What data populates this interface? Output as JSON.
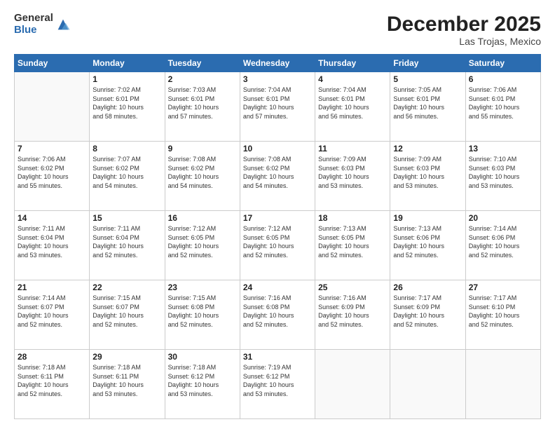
{
  "header": {
    "logo_general": "General",
    "logo_blue": "Blue",
    "month_title": "December 2025",
    "location": "Las Trojas, Mexico"
  },
  "days_of_week": [
    "Sunday",
    "Monday",
    "Tuesday",
    "Wednesday",
    "Thursday",
    "Friday",
    "Saturday"
  ],
  "weeks": [
    [
      {
        "day": "",
        "info": ""
      },
      {
        "day": "1",
        "info": "Sunrise: 7:02 AM\nSunset: 6:01 PM\nDaylight: 10 hours\nand 58 minutes."
      },
      {
        "day": "2",
        "info": "Sunrise: 7:03 AM\nSunset: 6:01 PM\nDaylight: 10 hours\nand 57 minutes."
      },
      {
        "day": "3",
        "info": "Sunrise: 7:04 AM\nSunset: 6:01 PM\nDaylight: 10 hours\nand 57 minutes."
      },
      {
        "day": "4",
        "info": "Sunrise: 7:04 AM\nSunset: 6:01 PM\nDaylight: 10 hours\nand 56 minutes."
      },
      {
        "day": "5",
        "info": "Sunrise: 7:05 AM\nSunset: 6:01 PM\nDaylight: 10 hours\nand 56 minutes."
      },
      {
        "day": "6",
        "info": "Sunrise: 7:06 AM\nSunset: 6:01 PM\nDaylight: 10 hours\nand 55 minutes."
      }
    ],
    [
      {
        "day": "7",
        "info": "Sunrise: 7:06 AM\nSunset: 6:02 PM\nDaylight: 10 hours\nand 55 minutes."
      },
      {
        "day": "8",
        "info": "Sunrise: 7:07 AM\nSunset: 6:02 PM\nDaylight: 10 hours\nand 54 minutes."
      },
      {
        "day": "9",
        "info": "Sunrise: 7:08 AM\nSunset: 6:02 PM\nDaylight: 10 hours\nand 54 minutes."
      },
      {
        "day": "10",
        "info": "Sunrise: 7:08 AM\nSunset: 6:02 PM\nDaylight: 10 hours\nand 54 minutes."
      },
      {
        "day": "11",
        "info": "Sunrise: 7:09 AM\nSunset: 6:03 PM\nDaylight: 10 hours\nand 53 minutes."
      },
      {
        "day": "12",
        "info": "Sunrise: 7:09 AM\nSunset: 6:03 PM\nDaylight: 10 hours\nand 53 minutes."
      },
      {
        "day": "13",
        "info": "Sunrise: 7:10 AM\nSunset: 6:03 PM\nDaylight: 10 hours\nand 53 minutes."
      }
    ],
    [
      {
        "day": "14",
        "info": "Sunrise: 7:11 AM\nSunset: 6:04 PM\nDaylight: 10 hours\nand 53 minutes."
      },
      {
        "day": "15",
        "info": "Sunrise: 7:11 AM\nSunset: 6:04 PM\nDaylight: 10 hours\nand 52 minutes."
      },
      {
        "day": "16",
        "info": "Sunrise: 7:12 AM\nSunset: 6:05 PM\nDaylight: 10 hours\nand 52 minutes."
      },
      {
        "day": "17",
        "info": "Sunrise: 7:12 AM\nSunset: 6:05 PM\nDaylight: 10 hours\nand 52 minutes."
      },
      {
        "day": "18",
        "info": "Sunrise: 7:13 AM\nSunset: 6:05 PM\nDaylight: 10 hours\nand 52 minutes."
      },
      {
        "day": "19",
        "info": "Sunrise: 7:13 AM\nSunset: 6:06 PM\nDaylight: 10 hours\nand 52 minutes."
      },
      {
        "day": "20",
        "info": "Sunrise: 7:14 AM\nSunset: 6:06 PM\nDaylight: 10 hours\nand 52 minutes."
      }
    ],
    [
      {
        "day": "21",
        "info": "Sunrise: 7:14 AM\nSunset: 6:07 PM\nDaylight: 10 hours\nand 52 minutes."
      },
      {
        "day": "22",
        "info": "Sunrise: 7:15 AM\nSunset: 6:07 PM\nDaylight: 10 hours\nand 52 minutes."
      },
      {
        "day": "23",
        "info": "Sunrise: 7:15 AM\nSunset: 6:08 PM\nDaylight: 10 hours\nand 52 minutes."
      },
      {
        "day": "24",
        "info": "Sunrise: 7:16 AM\nSunset: 6:08 PM\nDaylight: 10 hours\nand 52 minutes."
      },
      {
        "day": "25",
        "info": "Sunrise: 7:16 AM\nSunset: 6:09 PM\nDaylight: 10 hours\nand 52 minutes."
      },
      {
        "day": "26",
        "info": "Sunrise: 7:17 AM\nSunset: 6:09 PM\nDaylight: 10 hours\nand 52 minutes."
      },
      {
        "day": "27",
        "info": "Sunrise: 7:17 AM\nSunset: 6:10 PM\nDaylight: 10 hours\nand 52 minutes."
      }
    ],
    [
      {
        "day": "28",
        "info": "Sunrise: 7:18 AM\nSunset: 6:11 PM\nDaylight: 10 hours\nand 52 minutes."
      },
      {
        "day": "29",
        "info": "Sunrise: 7:18 AM\nSunset: 6:11 PM\nDaylight: 10 hours\nand 53 minutes."
      },
      {
        "day": "30",
        "info": "Sunrise: 7:18 AM\nSunset: 6:12 PM\nDaylight: 10 hours\nand 53 minutes."
      },
      {
        "day": "31",
        "info": "Sunrise: 7:19 AM\nSunset: 6:12 PM\nDaylight: 10 hours\nand 53 minutes."
      },
      {
        "day": "",
        "info": ""
      },
      {
        "day": "",
        "info": ""
      },
      {
        "day": "",
        "info": ""
      }
    ]
  ]
}
